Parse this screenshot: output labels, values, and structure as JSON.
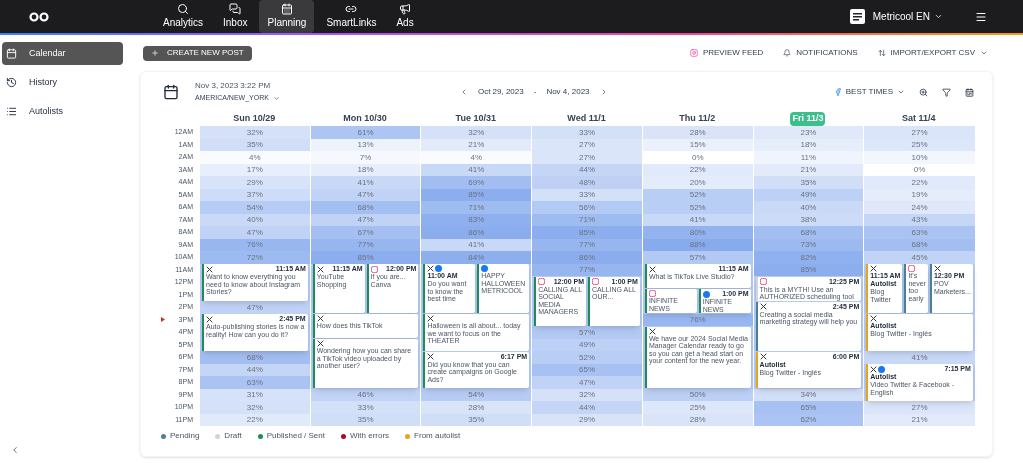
{
  "nav": [
    {
      "label": "Analytics",
      "selected": false
    },
    {
      "label": "Inbox",
      "selected": false
    },
    {
      "label": "Planning",
      "selected": true
    },
    {
      "label": "SmartLinks",
      "selected": false
    },
    {
      "label": "Ads",
      "selected": false
    }
  ],
  "account": {
    "name": "Metricool EN"
  },
  "sidebar": {
    "items": [
      {
        "label": "Calendar",
        "selected": true
      },
      {
        "label": "History",
        "selected": false
      },
      {
        "label": "Autolists",
        "selected": false
      }
    ]
  },
  "toolbar": {
    "create": "CREATE NEW POST",
    "actions": [
      {
        "label": "PREVIEW FEED"
      },
      {
        "label": "NOTIFICATIONS"
      },
      {
        "label": "IMPORT/EXPORT CSV"
      }
    ]
  },
  "header": {
    "now": "Nov 3, 2023 3:22 PM",
    "timezone": "AMERICA/NEW_YORK",
    "range_start": "Oct 29, 2023",
    "range_sep": "-",
    "range_end": "Nov 4, 2023",
    "best_times": "BEST TIMES"
  },
  "hours": [
    {
      "label": "12AM",
      "current": false
    },
    {
      "label": "1AM",
      "current": false
    },
    {
      "label": "2AM",
      "current": false
    },
    {
      "label": "3AM",
      "current": false
    },
    {
      "label": "4AM",
      "current": false
    },
    {
      "label": "5AM",
      "current": false
    },
    {
      "label": "6AM",
      "current": false
    },
    {
      "label": "7AM",
      "current": false
    },
    {
      "label": "8AM",
      "current": false
    },
    {
      "label": "9AM",
      "current": false
    },
    {
      "label": "10AM",
      "current": false
    },
    {
      "label": "11AM",
      "current": false
    },
    {
      "label": "12PM",
      "current": false
    },
    {
      "label": "1PM",
      "current": false
    },
    {
      "label": "2PM",
      "current": false
    },
    {
      "label": "3PM",
      "current": true
    },
    {
      "label": "4PM",
      "current": false
    },
    {
      "label": "5PM",
      "current": false
    },
    {
      "label": "6PM",
      "current": false
    },
    {
      "label": "7PM",
      "current": false
    },
    {
      "label": "8PM",
      "current": false
    },
    {
      "label": "9PM",
      "current": false
    },
    {
      "label": "10PM",
      "current": false
    },
    {
      "label": "11PM",
      "current": false
    }
  ],
  "days": [
    {
      "label": "Sun 10/29",
      "selected": false,
      "cells": [
        {
          "value": "32%"
        },
        {
          "value": "35%"
        },
        {
          "value": "4%"
        },
        {
          "value": "17%"
        },
        {
          "value": "29%"
        },
        {
          "value": "37%"
        },
        {
          "value": "54%"
        },
        {
          "value": "40%"
        },
        {
          "value": "47%"
        },
        {
          "value": "76%"
        },
        {
          "value": "72%"
        },
        {
          "posts": [
            {
              "color": "#1f8a5c",
              "networks": [
                {
                  "kind": "x"
                }
              ],
              "time": "11:15 AM",
              "text": "Want to know everything you need to know about Instagram Stories?"
            }
          ]
        },
        null,
        null,
        {
          "value": "47%"
        },
        {
          "posts": [
            {
              "color": "#1f8a5c",
              "networks": [
                {
                  "kind": "x"
                }
              ],
              "time": "2:45 PM",
              "text": "Auto-publishing stories is now a reality! How can you do it?"
            }
          ]
        },
        null,
        null,
        {
          "value": "68%"
        },
        {
          "value": "44%"
        },
        {
          "value": "63%"
        },
        {
          "value": "31%"
        },
        {
          "value": "32%"
        },
        {
          "value": "22%"
        }
      ]
    },
    {
      "label": "Mon 10/30",
      "selected": false,
      "cells": [
        {
          "value": "61%"
        },
        {
          "value": "13%"
        },
        {
          "value": "7%"
        },
        {
          "value": "18%"
        },
        {
          "value": "41%"
        },
        {
          "value": "47%"
        },
        {
          "value": "68%"
        },
        {
          "value": "47%"
        },
        {
          "value": "67%"
        },
        {
          "value": "77%"
        },
        {
          "value": "85%"
        },
        {
          "posts": [
            {
              "color": "#1f8a5c",
              "networks": [
                {
                  "kind": "x"
                }
              ],
              "time": "11:15 AM",
              "text": "YouTube Shopping"
            },
            {
              "color": "#1f8a5c",
              "networks": [
                {
                  "kind": "instagram"
                }
              ],
              "time": "12:00 PM",
              "text": "If you are... Canva"
            }
          ]
        },
        null,
        null,
        null,
        {
          "posts": [
            {
              "color": "#1f8a5c",
              "networks": [
                {
                  "kind": "x"
                }
              ],
              "text": "How does this TikTok"
            }
          ]
        },
        null,
        {
          "posts": [
            {
              "color": "#1f8a5c",
              "networks": [
                {
                  "kind": "x"
                }
              ],
              "text": "Wondering how you can share a TikTok video uploaded by another user?"
            }
          ]
        },
        null,
        null,
        null,
        {
          "value": "46%"
        },
        {
          "value": "33%"
        },
        {
          "value": "35%"
        }
      ]
    },
    {
      "label": "Tue 10/31",
      "selected": false,
      "cells": [
        {
          "value": "32%"
        },
        {
          "value": "21%"
        },
        {
          "value": "4%"
        },
        {
          "value": "41%"
        },
        {
          "value": "69%"
        },
        {
          "value": "85%"
        },
        {
          "value": "71%"
        },
        {
          "value": "83%"
        },
        {
          "value": "86%"
        },
        {
          "value": "41%"
        },
        {
          "value": "84%"
        },
        {
          "posts": [
            {
              "color": "#1f8a5c",
              "networks": [
                {
                  "kind": "x"
                },
                {
                  "kind": "facebook"
                }
              ],
              "time": "11:00 AM",
              "text": "Do you want to know the best time"
            },
            {
              "color": "#1f8a5c",
              "networks": [
                {
                  "kind": "facebook"
                }
              ],
              "text": "HAPPY HALLOWEEN METRICOOL"
            }
          ]
        },
        null,
        null,
        null,
        {
          "posts": [
            {
              "color": "#1f8a5c",
              "networks": [
                {
                  "kind": "x"
                }
              ],
              "text": "Halloween is all about... today we want to focus on the THEATER"
            }
          ]
        },
        null,
        null,
        {
          "posts": [
            {
              "color": "#1f8a5c",
              "networks": [
                {
                  "kind": "x"
                }
              ],
              "time": "6:17 PM",
              "text": "Did you know that you can create campaigns on Google Ads?"
            }
          ]
        },
        null,
        null,
        {
          "value": "54%"
        },
        {
          "value": "28%"
        },
        {
          "value": "35%"
        }
      ]
    },
    {
      "label": "Wed 11/1",
      "selected": false,
      "cells": [
        {
          "value": "33%"
        },
        {
          "value": "27%"
        },
        {
          "value": "27%"
        },
        {
          "value": "44%"
        },
        {
          "value": "48%"
        },
        {
          "value": "33%"
        },
        {
          "value": "56%"
        },
        {
          "value": "71%"
        },
        {
          "value": "85%"
        },
        {
          "value": "77%"
        },
        {
          "value": "86%"
        },
        {
          "value": "77%"
        },
        {
          "posts": [
            {
              "color": "#1f8a5c",
              "networks": [
                {
                  "kind": "instagram"
                }
              ],
              "time": "12:00 PM",
              "text": "CALLING ALL SOCIAL MEDIA MANAGERS"
            },
            {
              "color": "#1f8a5c",
              "networks": [
                {
                  "kind": "instagram"
                }
              ],
              "time": "1:00 PM",
              "text": "CALLING ALL OUR..."
            }
          ]
        },
        null,
        null,
        null,
        {
          "value": "57%"
        },
        {
          "value": "49%"
        },
        {
          "value": "52%"
        },
        {
          "value": "65%"
        },
        {
          "value": "47%"
        },
        {
          "value": "32%"
        },
        {
          "value": "44%"
        },
        {
          "value": "29%"
        }
      ]
    },
    {
      "label": "Thu 11/2",
      "selected": false,
      "cells": [
        {
          "value": "28%"
        },
        {
          "value": "15%"
        },
        {
          "value": "0%"
        },
        {
          "value": "22%"
        },
        {
          "value": "20%"
        },
        {
          "value": "52%"
        },
        {
          "value": "52%"
        },
        {
          "value": "41%"
        },
        {
          "value": "80%"
        },
        {
          "value": "88%"
        },
        {
          "value": "57%"
        },
        {
          "posts": [
            {
              "color": "#1f8a5c",
              "networks": [
                {
                  "kind": "x"
                }
              ],
              "time": "11:15 AM",
              "text": "What is TikTok Live Studio?"
            }
          ]
        },
        null,
        {
          "posts": [
            {
              "color": "#1f8a5c",
              "networks": [
                {
                  "kind": "instagram"
                }
              ],
              "text": "INFINITE NEWS"
            },
            {
              "color": "#1f8a5c",
              "networks": [
                {
                  "kind": "facebook"
                }
              ],
              "time": "1:00 PM",
              "text": "INFINITE NEWS"
            }
          ]
        },
        null,
        {
          "value": "76%"
        },
        {
          "posts": [
            {
              "color": "#1f8a5c",
              "networks": [
                {
                  "kind": "x"
                }
              ],
              "text": "We have our 2024 Social Media Manager Calendar ready to go so you can get a head start on your content for the new year."
            }
          ]
        },
        null,
        null,
        null,
        null,
        {
          "value": "50%"
        },
        {
          "value": "25%"
        },
        {
          "value": "28%"
        }
      ]
    },
    {
      "label": "Fri 11/3",
      "selected": true,
      "cells": [
        {
          "value": "23%"
        },
        {
          "value": "18%"
        },
        {
          "value": "11%"
        },
        {
          "value": "21%"
        },
        {
          "value": "35%"
        },
        {
          "value": "49%"
        },
        {
          "value": "40%"
        },
        {
          "value": "38%"
        },
        {
          "value": "68%"
        },
        {
          "value": "73%"
        },
        {
          "value": "82%"
        },
        {
          "value": "85%"
        },
        {
          "posts": [
            {
              "color": "#d4d4d4",
              "networks": [
                {
                  "kind": "instagram"
                }
              ],
              "time": "12:25 PM",
              "text": "This is a MYTH! Use an AUTHORIZED scheduling tool"
            }
          ]
        },
        null,
        {
          "posts": [
            {
              "color": "#4a7f95",
              "networks": [
                {
                  "kind": "x"
                }
              ],
              "time": "2:45 PM",
              "text": "Creating a social media marketing strategy will help you"
            }
          ]
        },
        null,
        null,
        null,
        {
          "posts": [
            {
              "color": "#e8a317",
              "networks": [
                {
                  "kind": "x"
                }
              ],
              "time": "6:00 PM",
              "tag": "Autolist",
              "text": "Blog Twitter - Inglés"
            }
          ]
        },
        null,
        null,
        {
          "value": "34%"
        },
        {
          "value": "65%"
        },
        {
          "value": "62%"
        }
      ]
    },
    {
      "label": "Sat 11/4",
      "selected": false,
      "cells": [
        {
          "value": "27%"
        },
        {
          "value": "25%"
        },
        {
          "value": "10%"
        },
        {
          "value": "0%"
        },
        {
          "value": "22%"
        },
        {
          "value": "19%"
        },
        {
          "value": "24%"
        },
        {
          "value": "43%"
        },
        {
          "value": "63%"
        },
        {
          "value": "68%"
        },
        {
          "value": "45%"
        },
        {
          "posts": [
            {
              "color": "#e8a317",
              "networks": [
                {
                  "kind": "x"
                }
              ],
              "time": "11:15 AM",
              "tag": "Autolist",
              "text": "Blog Twitter"
            },
            {
              "color": "#4a7f95",
              "networks": [
                {
                  "kind": "instagram"
                }
              ],
              "text": "It's never too early"
            },
            {
              "color": "#4a7f95",
              "networks": [
                {
                  "kind": "x"
                }
              ],
              "time": "12:30 PM",
              "text": "POV Marketers..."
            }
          ]
        },
        null,
        null,
        null,
        {
          "posts": [
            {
              "color": "#e8a317",
              "networks": [
                {
                  "kind": "x"
                }
              ],
              "tag": "Autolist",
              "text": "Blog Twitter - Inglés"
            }
          ]
        },
        null,
        null,
        {
          "value": "41%"
        },
        {
          "posts": [
            {
              "color": "#e8a317",
              "networks": [
                {
                  "kind": "x"
                },
                {
                  "kind": "facebook"
                }
              ],
              "time": "7:15 PM",
              "tag": "Autolist",
              "text": "Video Twitter & Facebook - English"
            }
          ]
        },
        null,
        null,
        {
          "value": "27%"
        },
        {
          "value": "21%"
        }
      ]
    }
  ],
  "legend": [
    {
      "label": "Pending",
      "color": "#4a7f95"
    },
    {
      "label": "Draft",
      "color": "#d4d4d4"
    },
    {
      "label": "Published / Sent",
      "color": "#1f8a5c"
    },
    {
      "label": "With errors",
      "color": "#a0101e"
    },
    {
      "label": "From autolist",
      "color": "#e8a317"
    }
  ]
}
